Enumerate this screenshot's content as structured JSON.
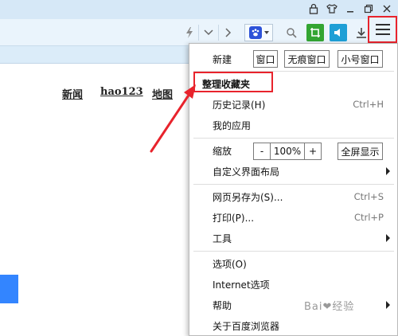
{
  "page": {
    "links": [
      "新闻",
      "hao123",
      "地图"
    ],
    "search_button_label": ""
  },
  "toolbar": {
    "icons": [
      "lightning-icon",
      "chevron-down-icon",
      "chevron-right-icon",
      "baidu-paw-icon",
      "search-icon",
      "crop-icon",
      "sound-icon",
      "download-icon",
      "hamburger-menu-icon"
    ]
  },
  "menu": {
    "new_label": "新建",
    "new_window": "窗口",
    "new_incognito": "无痕窗口",
    "new_small_window": "小号窗口",
    "organize_favorites": "整理收藏夹",
    "history": "历史记录(H)",
    "history_shortcut": "Ctrl+H",
    "my_apps": "我的应用",
    "zoom_label": "缩放",
    "zoom_minus": "-",
    "zoom_value": "100%",
    "zoom_plus": "+",
    "fullscreen": "全屏显示",
    "customize_layout": "自定义界面布局",
    "save_as": "网页另存为(S)...",
    "save_as_shortcut": "Ctrl+S",
    "print": "打印(P)...",
    "print_shortcut": "Ctrl+P",
    "tools": "工具",
    "options": "选项(O)",
    "internet_options": "Internet选项",
    "help": "帮助",
    "about": "关于百度浏览器"
  },
  "colors": {
    "annotation_red": "#e8232c",
    "chrome_blue": "#eaf4fc",
    "search_button_blue": "#3385ff"
  }
}
